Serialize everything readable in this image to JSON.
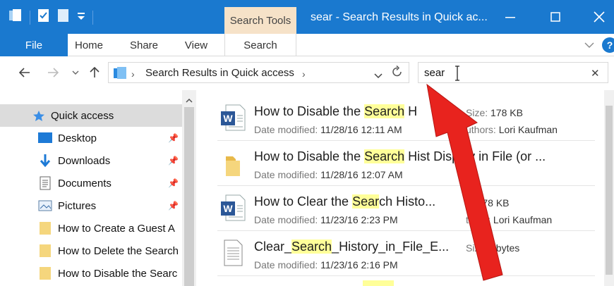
{
  "window": {
    "title": "sear - Search Results in Quick ac...",
    "context_tab": "Search Tools"
  },
  "ribbon": {
    "tabs": [
      "File",
      "Home",
      "Share",
      "View",
      "Search"
    ]
  },
  "address": {
    "location": "Search Results in Quick access",
    "search_value": "sear"
  },
  "sidebar": {
    "items": [
      {
        "label": "Quick access",
        "icon": "star-icon",
        "pinned": false
      },
      {
        "label": "Desktop",
        "icon": "desktop-icon",
        "pinned": true
      },
      {
        "label": "Downloads",
        "icon": "download-arrow-icon",
        "pinned": true
      },
      {
        "label": "Documents",
        "icon": "documents-icon",
        "pinned": true
      },
      {
        "label": "Pictures",
        "icon": "pictures-icon",
        "pinned": true
      },
      {
        "label": "How to Create a Guest A",
        "icon": "folder-icon",
        "pinned": false
      },
      {
        "label": "How to Delete the Search",
        "icon": "folder-icon",
        "pinned": false
      },
      {
        "label": "How to Disable the Searc",
        "icon": "folder-icon",
        "pinned": false
      }
    ]
  },
  "files": [
    {
      "icon": "word-document-icon",
      "name_pre": "How to Disable the ",
      "name_hl": "Search",
      "name_post": " H",
      "date_label": "Date modified:",
      "date": "11/28/16 12:11 AM",
      "meta1_label": "Size:",
      "meta1": "178 KB",
      "meta2_label": "uthors:",
      "meta2": "Lori Kaufman"
    },
    {
      "icon": "folder-icon",
      "name_pre": "How to Disable the ",
      "name_hl": "Search",
      "name_post": " Hist  Display in File (or ...",
      "date_label": "Date modified:",
      "date": "11/28/16 12:07 AM",
      "meta1_label": "",
      "meta1": "",
      "meta2_label": "",
      "meta2": ""
    },
    {
      "icon": "word-document-icon",
      "name_pre": "How to Clear the ",
      "name_hl": "Sear",
      "name_post": "ch Histo...",
      "date_label": "Date modified:",
      "date": "11/23/16 2:23 PM",
      "meta1_label": "e:",
      "meta1": "178 KB",
      "meta2_label": "thors:",
      "meta2": "Lori Kaufman"
    },
    {
      "icon": "text-file-icon",
      "name_pre": "Clear_",
      "name_hl": "Search",
      "name_post": "_History_in_File_E...",
      "date_label": "Date modified:",
      "date": "11/23/16 2:16 PM",
      "meta1_label": "Siz",
      "meta1": "62 bytes",
      "meta2_label": "",
      "meta2": ""
    }
  ],
  "colors": {
    "titlebar": "#1a79cf",
    "context_tab": "#f6e2c8",
    "highlight": "#ffff99",
    "selection": "#dcdcdc",
    "annotation_arrow": "#e8231e"
  }
}
